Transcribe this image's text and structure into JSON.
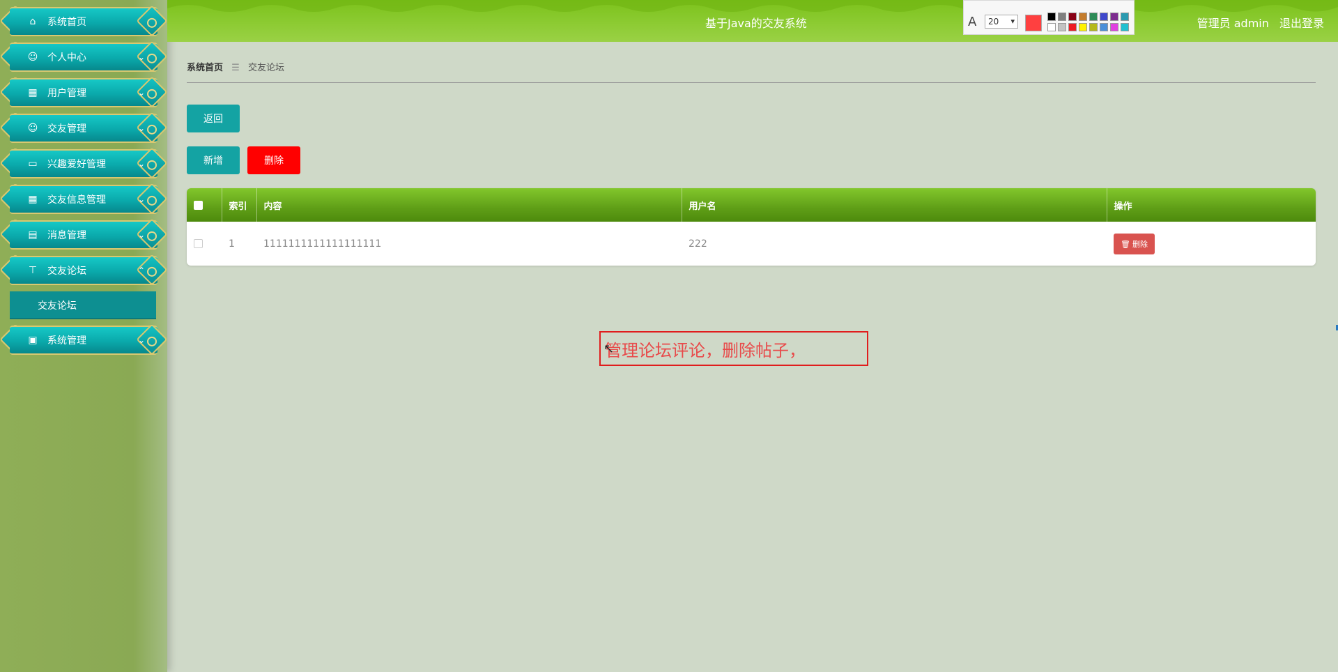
{
  "sidebar": {
    "items": [
      {
        "label": "系统首页",
        "icon": "home-icon",
        "glyph": "⌂",
        "chevron": ""
      },
      {
        "label": "个人中心",
        "icon": "user-icon",
        "glyph": "☺",
        "chevron": "⌄"
      },
      {
        "label": "用户管理",
        "icon": "grid-icon",
        "glyph": "▦",
        "chevron": "⌄"
      },
      {
        "label": "交友管理",
        "icon": "user-icon",
        "glyph": "☺",
        "chevron": "⌄"
      },
      {
        "label": "兴趣爱好管理",
        "icon": "monitor-icon",
        "glyph": "▭",
        "chevron": "⌄"
      },
      {
        "label": "交友信息管理",
        "icon": "grid-icon",
        "glyph": "▦",
        "chevron": "⌄"
      },
      {
        "label": "消息管理",
        "icon": "clipboard-icon",
        "glyph": "▤",
        "chevron": "⌄"
      },
      {
        "label": "交友论坛",
        "icon": "pin-icon",
        "glyph": "⊤",
        "chevron": "⌃"
      },
      {
        "label": "系统管理",
        "icon": "settings-box-icon",
        "glyph": "▣",
        "chevron": "⌄"
      }
    ],
    "sub_item": "交友论坛"
  },
  "header": {
    "title": "基于Java的交友系统",
    "user_role": "管理员 admin",
    "logout": "退出登录"
  },
  "annotation_toolbar": {
    "font_size": "20",
    "current_color": "#ff4040",
    "swatches": [
      "#000000",
      "#7f7f7f",
      "#880015",
      "#c47c2c",
      "#2e8b57",
      "#3f48cc",
      "#7d2c8f",
      "#2a9ab0",
      "#ffffff",
      "#c3c3c3",
      "#ed1c24",
      "#fff200",
      "#b5b81a",
      "#4a90d9",
      "#e040e0",
      "#22c0d0"
    ]
  },
  "breadcrumb": {
    "home": "系统首页",
    "separator": "☰",
    "current": "交友论坛"
  },
  "buttons": {
    "back": "返回",
    "add": "新增",
    "delete": "删除"
  },
  "table": {
    "headers": {
      "index": "索引",
      "content": "内容",
      "username": "用户名",
      "actions": "操作"
    },
    "rows": [
      {
        "index": "1",
        "content": "1111111111111111111",
        "username": "222",
        "delete_label": "删除"
      }
    ]
  },
  "note": {
    "text": "管理论坛评论，删除帖子，"
  }
}
